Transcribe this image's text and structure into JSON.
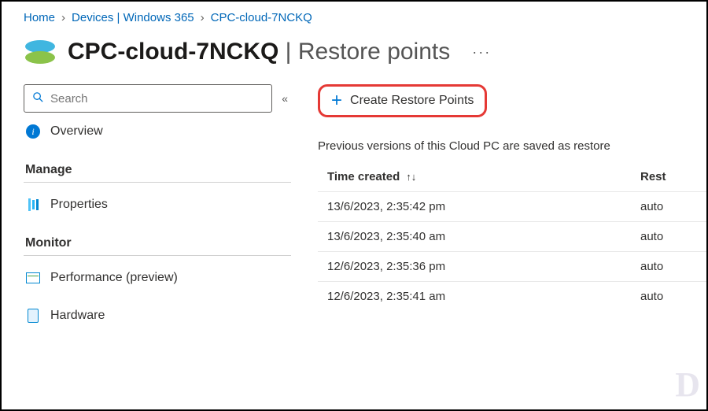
{
  "breadcrumb": {
    "items": [
      "Home",
      "Devices | Windows 365",
      "CPC-cloud-7NCKQ"
    ]
  },
  "header": {
    "entity": "CPC-cloud-7NCKQ",
    "divider": " | ",
    "page": "Restore points",
    "more": "···"
  },
  "search": {
    "placeholder": "Search"
  },
  "sidebar": {
    "overview": "Overview",
    "sections": {
      "manage": "Manage",
      "monitor": "Monitor"
    },
    "items": {
      "properties": "Properties",
      "performance": "Performance (preview)",
      "hardware": "Hardware"
    }
  },
  "toolbar": {
    "create_label": "Create Restore Points"
  },
  "main": {
    "description": "Previous versions of this Cloud PC are saved as restore",
    "columns": {
      "time": "Time created",
      "type": "Rest"
    },
    "rows": [
      {
        "time": "13/6/2023, 2:35:42 pm",
        "type": "auto"
      },
      {
        "time": "13/6/2023, 2:35:40 am",
        "type": "auto"
      },
      {
        "time": "12/6/2023, 2:35:36 pm",
        "type": "auto"
      },
      {
        "time": "12/6/2023, 2:35:41 am",
        "type": "auto"
      }
    ]
  }
}
